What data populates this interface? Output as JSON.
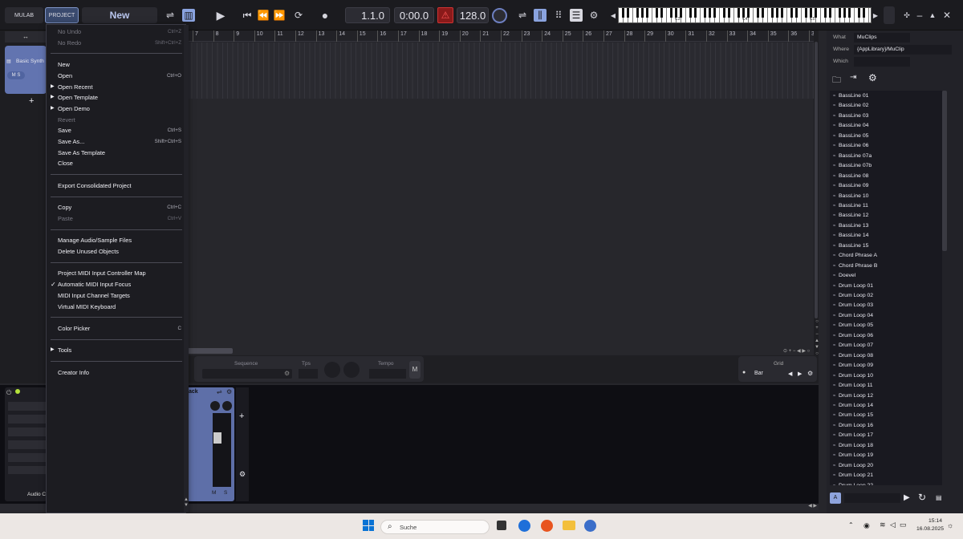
{
  "topbar": {
    "mulab": "MULAB",
    "project": "PROJECT",
    "new": "New",
    "position": "1.1.0",
    "time": "0:00.0",
    "tempo": "128.0"
  },
  "piano": {
    "labels": [
      "C3",
      "C4",
      "C5"
    ]
  },
  "ruler": [
    "7",
    "8",
    "9",
    "10",
    "11",
    "12",
    "13",
    "14",
    "15",
    "16",
    "17",
    "18",
    "19",
    "20",
    "21",
    "22",
    "23",
    "24",
    "25",
    "26",
    "27",
    "28",
    "29",
    "30",
    "31",
    "32",
    "33",
    "34",
    "35",
    "36",
    "37"
  ],
  "track": {
    "name": "Basic Synth",
    "m": "M",
    "s": "S"
  },
  "menu": [
    {
      "label": "No Undo",
      "shortcut": "Ctrl+Z",
      "disabled": true
    },
    {
      "label": "No Redo",
      "shortcut": "Shift+Ctrl+Z",
      "disabled": true
    },
    {
      "sep": true
    },
    {
      "label": "New",
      "shortcut": ""
    },
    {
      "label": "Open",
      "shortcut": "Ctrl+O"
    },
    {
      "label": "Open Recent",
      "shortcut": "",
      "sub": true
    },
    {
      "label": "Open Template",
      "shortcut": "",
      "sub": true
    },
    {
      "label": "Open Demo",
      "shortcut": "",
      "sub": true
    },
    {
      "label": "Revert",
      "shortcut": "",
      "disabled": true
    },
    {
      "label": "Save",
      "shortcut": "Ctrl+S"
    },
    {
      "label": "Save As...",
      "shortcut": "Shift+Ctrl+S"
    },
    {
      "label": "Save As Template",
      "shortcut": ""
    },
    {
      "label": "Close",
      "shortcut": ""
    },
    {
      "sep": true
    },
    {
      "label": "Export Consolidated Project",
      "shortcut": ""
    },
    {
      "sep": true
    },
    {
      "label": "Copy",
      "shortcut": "Ctrl+C"
    },
    {
      "label": "Paste",
      "shortcut": "Ctrl+V",
      "disabled": true
    },
    {
      "sep": true
    },
    {
      "label": "Manage Audio/Sample Files",
      "shortcut": ""
    },
    {
      "label": "Delete Unused Objects",
      "shortcut": ""
    },
    {
      "sep": true
    },
    {
      "label": "Project MIDI Input Controller Map",
      "shortcut": ""
    },
    {
      "label": "Automatic MIDI Input Focus",
      "shortcut": "",
      "check": true
    },
    {
      "label": "MIDI Input Channel Targets",
      "shortcut": ""
    },
    {
      "label": "Virtual MIDI Keyboard",
      "shortcut": ""
    },
    {
      "sep": true
    },
    {
      "label": "Color Picker",
      "shortcut": "C"
    },
    {
      "sep": true
    },
    {
      "label": "Tools",
      "shortcut": "",
      "sub": true
    },
    {
      "sep": true
    },
    {
      "label": "Creator Info",
      "shortcut": ""
    }
  ],
  "midbar": {
    "sequence": "Sequence",
    "tps": "Tps",
    "tempo": "Tempo",
    "m": "M",
    "grid": "Grid",
    "bar": "Bar"
  },
  "mixer": {
    "audio": "Audio C",
    "rack": "ack",
    "m": "M",
    "s": "S"
  },
  "browser": {
    "what_label": "What",
    "what": "MuClips",
    "where_label": "Where",
    "where": "{AppLibrary}/MuClip",
    "which_label": "Which",
    "which": "",
    "items": [
      "BassLine 01",
      "BassLine 02",
      "BassLine 03",
      "BassLine 04",
      "BassLine 05",
      "BassLine 06",
      "BassLine 07a",
      "BassLine 07b",
      "BassLine 08",
      "BassLine 09",
      "BassLine 10",
      "BassLine 11",
      "BassLine 12",
      "BassLine 13",
      "BassLine 14",
      "BassLine 15",
      "Chord Phrase A",
      "Chord Phrase B",
      "Doevel",
      "Drum Loop 01",
      "Drum Loop 02",
      "Drum Loop 03",
      "Drum Loop 04",
      "Drum Loop 05",
      "Drum Loop 06",
      "Drum Loop 07",
      "Drum Loop 08",
      "Drum Loop 09",
      "Drum Loop 10",
      "Drum Loop 11",
      "Drum Loop 12",
      "Drum Loop 14",
      "Drum Loop 15",
      "Drum Loop 16",
      "Drum Loop 17",
      "Drum Loop 18",
      "Drum Loop 19",
      "Drum Loop 20",
      "Drum Loop 21",
      "Drum Loop 22"
    ],
    "a": "A"
  },
  "taskbar": {
    "search": "Suche",
    "time": "15:14",
    "date": "16.08.2025"
  }
}
